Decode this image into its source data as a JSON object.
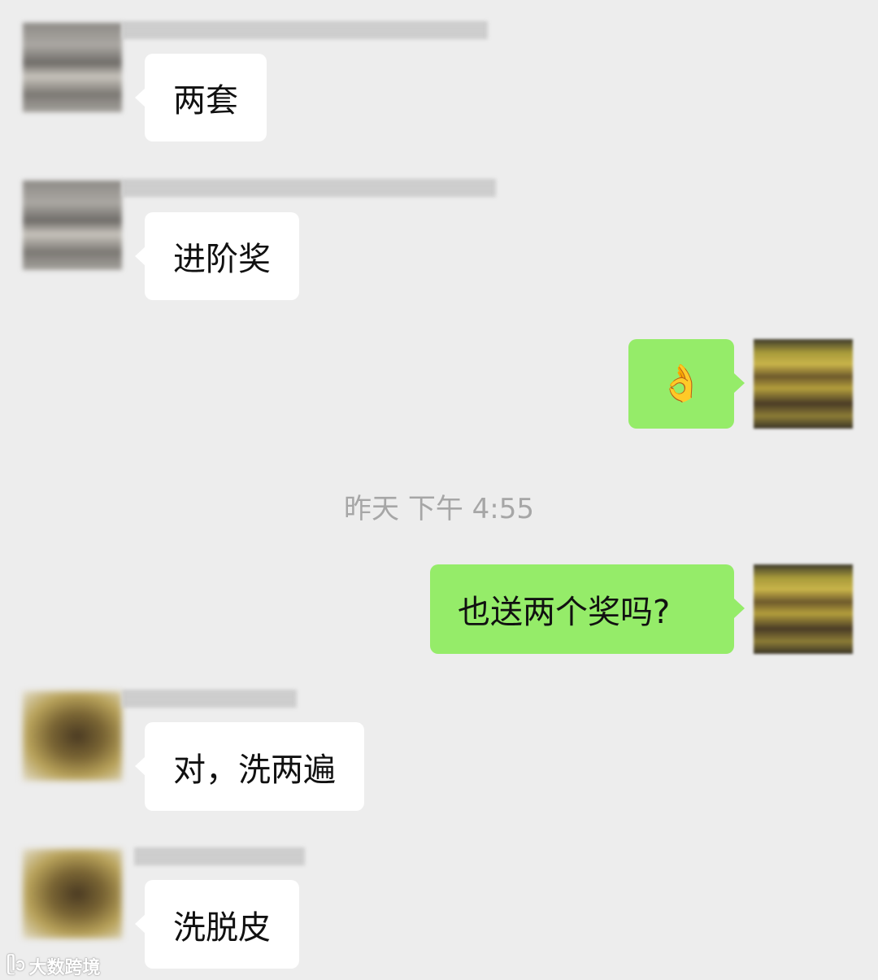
{
  "chat": {
    "timestamp": "昨天 下午 4:55",
    "messages": [
      {
        "side": "incoming",
        "text": "两套"
      },
      {
        "side": "incoming",
        "text": "进阶奖"
      },
      {
        "side": "outgoing",
        "emoji": "👌"
      },
      {
        "side": "outgoing",
        "text": "也送两个奖吗?"
      },
      {
        "side": "incoming",
        "text": "对，洗两遍"
      },
      {
        "side": "incoming",
        "text": "洗脱皮"
      }
    ]
  },
  "watermark": {
    "logo": "ᥫᩣ",
    "text": "大数跨境"
  },
  "colors": {
    "background": "#ededed",
    "incoming_bubble": "#ffffff",
    "outgoing_bubble": "#95ec69",
    "timestamp_text": "#a6a6a6"
  }
}
